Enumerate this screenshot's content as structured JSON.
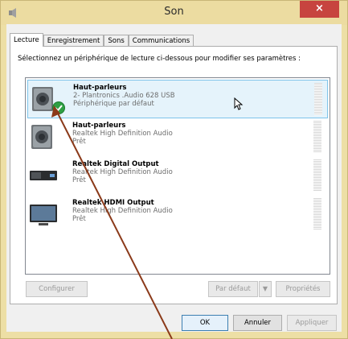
{
  "window": {
    "title": "Son",
    "close_glyph": "×"
  },
  "tabs": [
    {
      "label": "Lecture",
      "active": true
    },
    {
      "label": "Enregistrement",
      "active": false
    },
    {
      "label": "Sons",
      "active": false
    },
    {
      "label": "Communications",
      "active": false
    }
  ],
  "instruction": "Sélectionnez un périphérique de lecture ci-dessous pour modifier ses paramètres :",
  "devices": [
    {
      "name": "Haut-parleurs",
      "line2": "2- Plantronics .Audio 628 USB",
      "line3": "Périphérique par défaut",
      "icon": "speaker-icon",
      "selected": true,
      "default": true
    },
    {
      "name": "Haut-parleurs",
      "line2": "Realtek High Definition Audio",
      "line3": "Prêt",
      "icon": "speaker-icon",
      "selected": false,
      "default": false
    },
    {
      "name": "Realtek Digital Output",
      "line2": "Realtek High Definition Audio",
      "line3": "Prêt",
      "icon": "digital-output-icon",
      "selected": false,
      "default": false
    },
    {
      "name": "Realtek HDMI Output",
      "line2": "Realtek High Definition Audio",
      "line3": "Prêt",
      "icon": "monitor-icon",
      "selected": false,
      "default": false
    }
  ],
  "buttons": {
    "configure": "Configurer",
    "set_default": "Par défaut",
    "properties": "Propriétés",
    "ok": "OK",
    "cancel": "Annuler",
    "apply": "Appliquer"
  },
  "colors": {
    "title_bar": "#ecdca1",
    "close": "#c7443f",
    "selection": "#e5f3fb",
    "annotation_arrow": "#8b3a1a"
  }
}
